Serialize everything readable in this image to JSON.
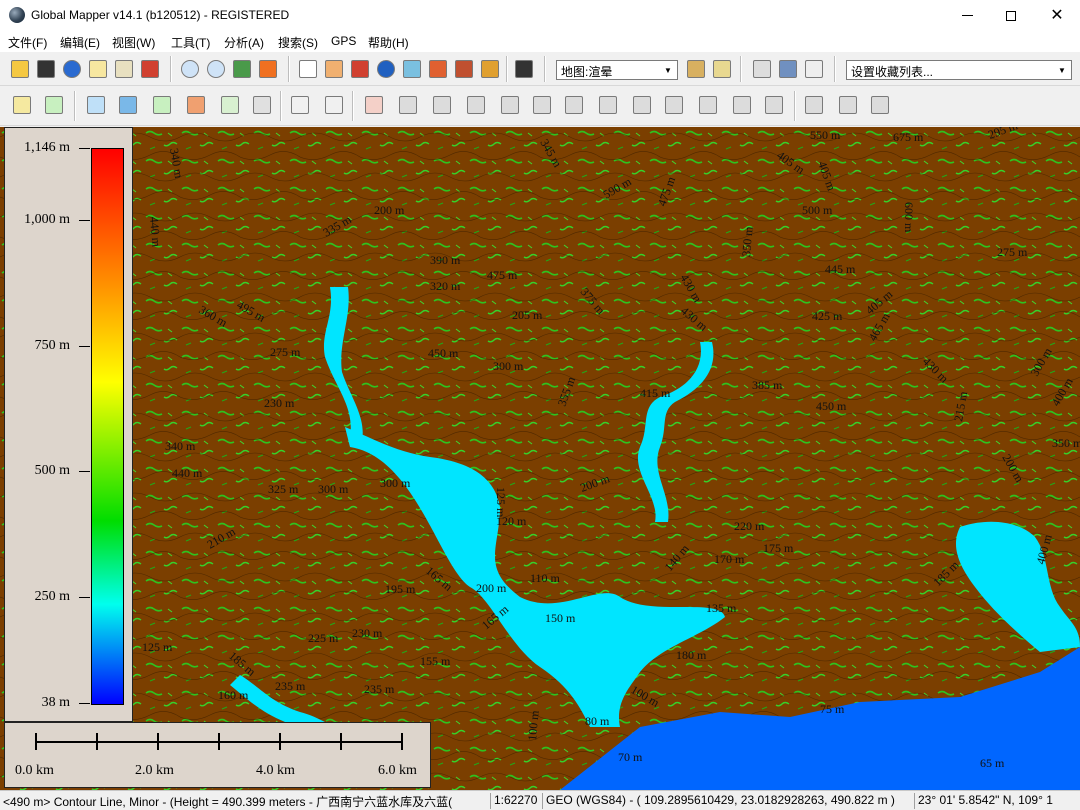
{
  "window": {
    "title": "Global Mapper v14.1 (b120512) - REGISTERED",
    "minimize_glyph": "—",
    "maximize_glyph": "□",
    "close_glyph": "✕"
  },
  "menu": [
    "文件(F)",
    "编辑(E)",
    "视图(W)",
    "工具(T)",
    "分析(A)",
    "搜索(S)",
    "GPS",
    "帮助(H)"
  ],
  "toolbar": {
    "map_style_combo": "地图:渲晕",
    "favorites_combo": "设置收藏列表..."
  },
  "legend": {
    "labels": [
      "1,146 m",
      "1,000 m",
      "750 m",
      "500 m",
      "250 m",
      "38 m"
    ],
    "gradient_colors": [
      "#ff0000",
      "#ff8800",
      "#ffff00",
      "#00dd00",
      "#00ffee",
      "#0000ff"
    ]
  },
  "scalebar": {
    "labels": [
      "0.0 km",
      "2.0 km",
      "4.0 km",
      "6.0 km"
    ]
  },
  "map": {
    "colors": {
      "land": "#7b3f00",
      "water": "#00e5ff",
      "deep": "#0066ff",
      "green": "#2ec21f"
    },
    "contour_labels": [
      "340 m",
      "200 m",
      "345 m",
      "590 m",
      "475 m",
      "550 m",
      "675 m",
      "295 m",
      "405 m",
      "405 m",
      "500 m",
      "600 m",
      "440 m",
      "335 m",
      "390 m",
      "475 m",
      "320 m",
      "430 m",
      "350 m",
      "445 m",
      "275 m",
      "375 m",
      "205 m",
      "495 m",
      "430 m",
      "425 m",
      "360 m",
      "405 m",
      "275 m",
      "450 m",
      "300 m",
      "355 m",
      "385 m",
      "415 m",
      "465 m",
      "300 m",
      "215 m",
      "230 m",
      "450 m",
      "430 m",
      "400 m",
      "200 m",
      "340 m",
      "440 m",
      "325 m",
      "300 m",
      "125 m",
      "200 m",
      "300 m",
      "350 m",
      "210 m",
      "120 m",
      "110 m",
      "165 m",
      "195 m",
      "200 m",
      "140 m",
      "170 m",
      "175 m",
      "220 m",
      "150 m",
      "135 m",
      "185 m",
      "225 m",
      "230 m",
      "155 m",
      "125 m",
      "185 m",
      "100 m",
      "180 m",
      "165 m",
      "75 m",
      "70 m",
      "65 m",
      "80 m",
      "100 m",
      "160 m",
      "235 m",
      "235 m",
      "400 m"
    ]
  },
  "status": {
    "feature": "<490 m> Contour Line, Minor - (Height = 490.399 meters - 广西南宁六蓝水库及六蓝(",
    "scale": "1:62270",
    "coords": "GEO (WGS84) - ( 109.2895610429, 23.0182928263, 490.822 m )",
    "dms": "23° 01' 5.8542\" N, 109° 1"
  }
}
